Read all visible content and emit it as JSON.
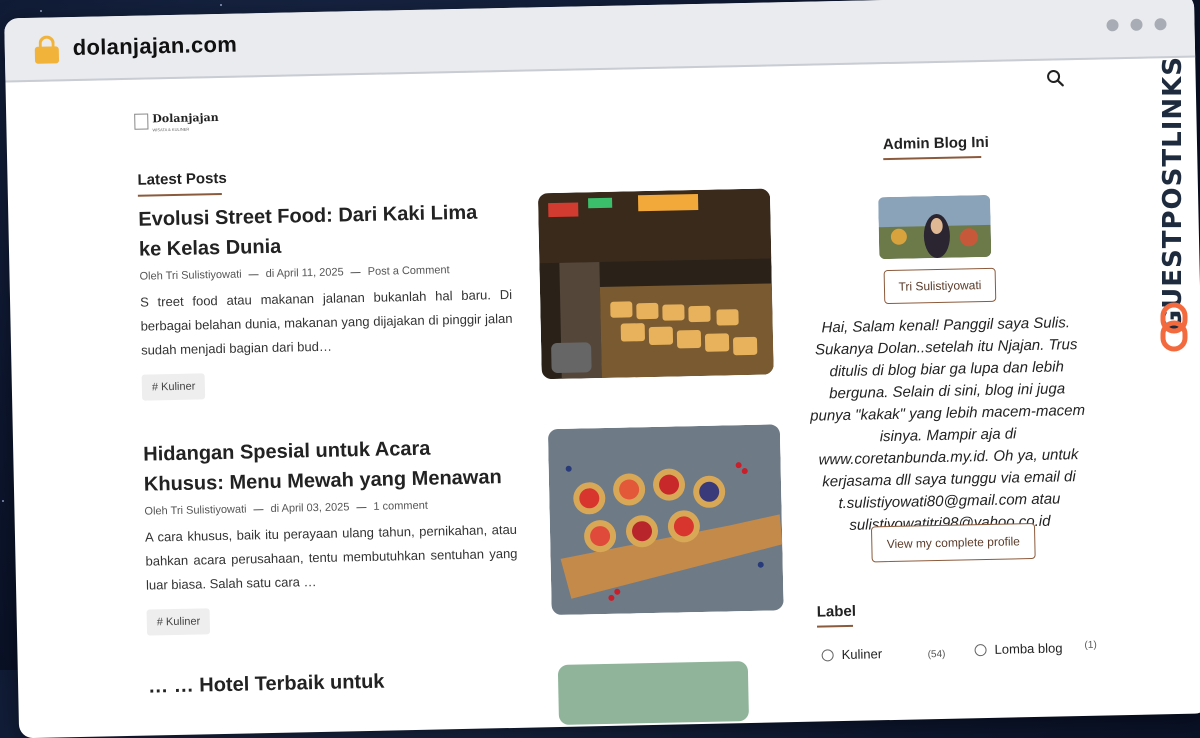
{
  "browser": {
    "url": "dolanjajan.com"
  },
  "site": {
    "logo_text": "Dolanjajan",
    "logo_sub": "WISATA & KULINER"
  },
  "main": {
    "section_title": "Latest Posts",
    "posts": [
      {
        "title": "Evolusi Street Food: Dari Kaki Lima ke Kelas Dunia",
        "author": "Oleh Tri Sulistiyowati",
        "date": "di April 11, 2025",
        "comments": "Post a Comment",
        "excerpt": "S treet food atau makanan jalanan bukanlah hal baru. Di berbagai belahan dunia, makanan yang dijajakan di pinggir jalan sudah menjadi bagian dari bud…",
        "tag": "# Kuliner"
      },
      {
        "title": "Hidangan Spesial untuk Acara Khusus: Menu Mewah yang Menawan",
        "author": "Oleh Tri Sulistiyowati",
        "date": "di April 03, 2025",
        "comments": "1 comment",
        "excerpt": "A cara khusus, baik itu perayaan ulang tahun, pernikahan, atau bahkan acara perusahaan, tentu membutuhkan sentuhan yang luar biasa. Salah satu cara …",
        "tag": "# Kuliner"
      },
      {
        "title": "… … Hotel Terbaik untuk"
      }
    ]
  },
  "sidebar": {
    "admin_title": "Admin Blog Ini",
    "admin_name": "Tri Sulistiyowati",
    "bio": "Hai, Salam kenal! Panggil saya Sulis. Sukanya Dolan..setelah itu Njajan. Trus ditulis di blog biar ga lupa dan lebih berguna. Selain di sini, blog ini juga punya \"kakak\" yang lebih macem-macem isinya. Mampir aja di www.coretanbunda.my.id. Oh ya, untuk kerjasama dll saya tunggu via email di t.sulistiyowati80@gmail.com atau sulistiyowatitri98@yahoo.co.id",
    "profile_button": "View my complete profile",
    "label_title": "Label",
    "labels": [
      {
        "name": "Kuliner",
        "count": "(54)"
      },
      {
        "name": "Lomba blog",
        "count": "(1)"
      }
    ]
  },
  "watermark": {
    "text": "GUESTPOSTLINKS"
  },
  "colors": {
    "accent": "#8b5a3c",
    "watermark_orange": "#f26a3d"
  }
}
